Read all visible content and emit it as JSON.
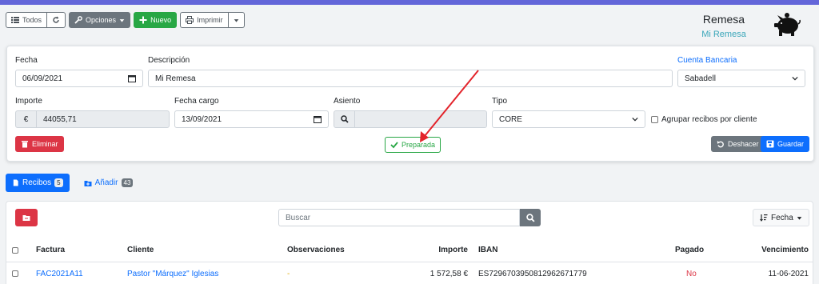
{
  "toolbar": {
    "all_label": "Todos",
    "options_label": "Opciones",
    "new_label": "Nuevo",
    "print_label": "Imprimir"
  },
  "header": {
    "title": "Remesa",
    "subtitle": "Mi Remesa"
  },
  "form": {
    "fecha_label": "Fecha",
    "fecha_value": "06/09/2021",
    "descripcion_label": "Descripción",
    "descripcion_value": "Mi Remesa",
    "cuenta_label": "Cuenta Bancaria",
    "cuenta_value": "Sabadell",
    "importe_label": "Importe",
    "currency_symbol": "€",
    "importe_value": "44055,71",
    "fecha_cargo_label": "Fecha cargo",
    "fecha_cargo_value": "13/09/2021",
    "asiento_label": "Asiento",
    "asiento_value": "",
    "tipo_label": "Tipo",
    "tipo_value": "CORE",
    "agrupar_label": "Agrupar recibos por cliente",
    "eliminar_label": "Eliminar",
    "status_label": "Preparada",
    "deshacer_label": "Deshacer",
    "guardar_label": "Guardar"
  },
  "tabs": [
    {
      "label": "Recibos",
      "count": "5"
    },
    {
      "label": "Añadir",
      "count": "43"
    }
  ],
  "list": {
    "search_placeholder": "Buscar",
    "sort_label": "Fecha",
    "columns": [
      "Factura",
      "Cliente",
      "Observaciones",
      "Importe",
      "IBAN",
      "Pagado",
      "Vencimiento"
    ],
    "rows": [
      {
        "factura": "FAC2021A11",
        "cliente": "Pastor \"Márquez\" Iglesias",
        "observaciones": "-",
        "importe": "1 572,58 €",
        "iban": "ES7296703950812962671779",
        "pagado": "No",
        "vencimiento": "11-06-2021"
      }
    ]
  },
  "colors": {
    "accent": "#6366d9",
    "primary": "#0d6efd",
    "success": "#28a745",
    "danger": "#dc3545",
    "teal": "#3aa6b9"
  }
}
